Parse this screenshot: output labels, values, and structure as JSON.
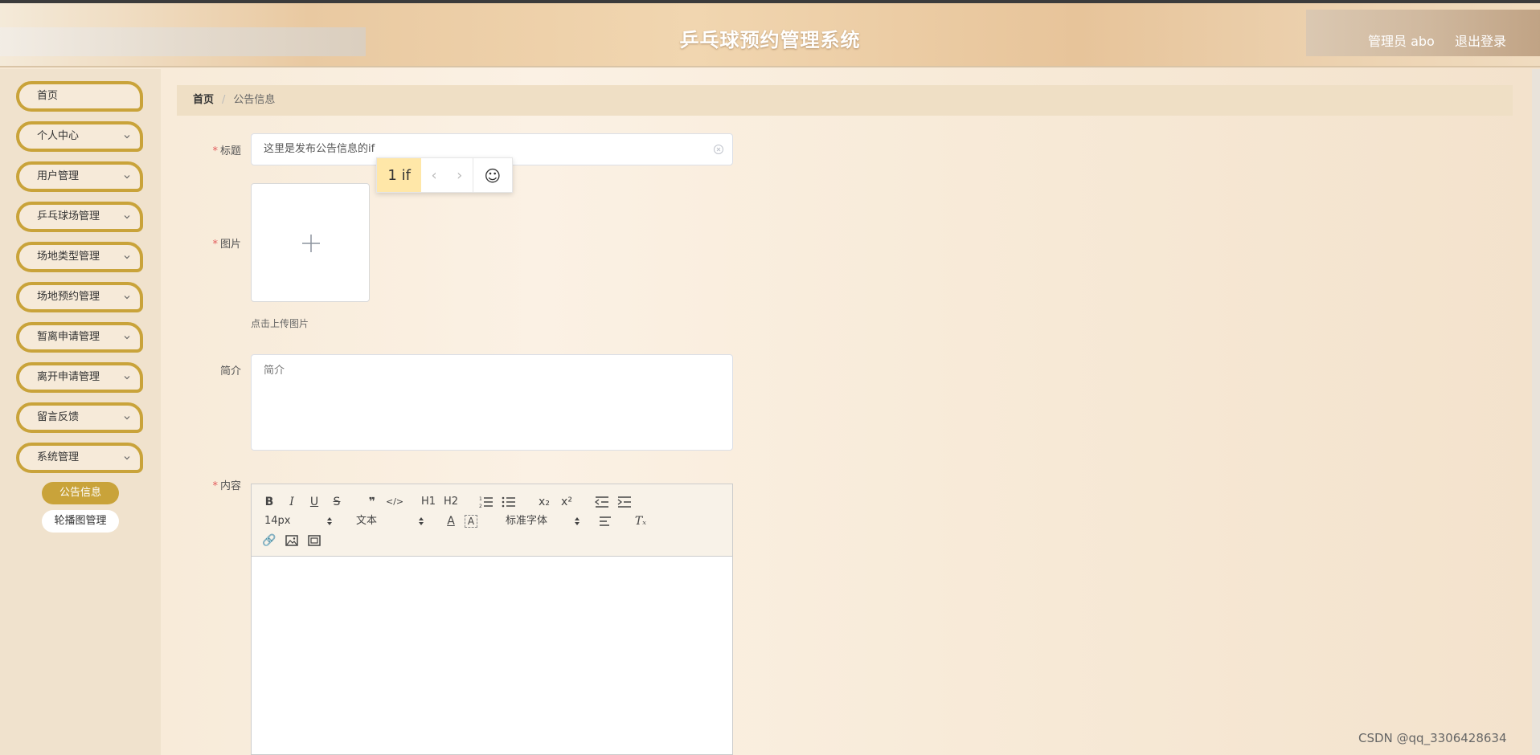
{
  "header": {
    "title": "乒乓球预约管理系统",
    "user": "管理员 abo",
    "logout": "退出登录"
  },
  "sidebar": {
    "items": [
      {
        "label": "首页",
        "has_arrow": false
      },
      {
        "label": "个人中心",
        "has_arrow": true
      },
      {
        "label": "用户管理",
        "has_arrow": true
      },
      {
        "label": "乒乓球场管理",
        "has_arrow": true
      },
      {
        "label": "场地类型管理",
        "has_arrow": true
      },
      {
        "label": "场地预约管理",
        "has_arrow": true
      },
      {
        "label": "暂离申请管理",
        "has_arrow": true
      },
      {
        "label": "离开申请管理",
        "has_arrow": true
      },
      {
        "label": "留言反馈",
        "has_arrow": true
      },
      {
        "label": "系统管理",
        "has_arrow": true
      }
    ],
    "sub_items": [
      {
        "label": "公告信息",
        "active": true
      },
      {
        "label": "轮播图管理",
        "active": false
      }
    ]
  },
  "breadcrumb": {
    "home": "首页",
    "separator": "/",
    "current": "公告信息"
  },
  "form": {
    "required_mark": "*",
    "title_label": "标题",
    "title_value": "这里是发布公告信息的if",
    "image_label": "图片",
    "upload_tip": "点击上传图片",
    "intro_label": "简介",
    "intro_placeholder": "简介",
    "content_label": "内容"
  },
  "ime": {
    "candidate": "1 if"
  },
  "editor": {
    "font_size": "14px",
    "header_select": "文本",
    "font_family": "标准字体",
    "h1": "H1",
    "h2": "H2"
  },
  "watermark": "CSDN @qq_3306428634",
  "colors": {
    "accent": "#c9a33a",
    "breadcrumb_bg": "#efdfc5",
    "sidebar_bg": "#f0e2cd",
    "required": "#e25b5b"
  }
}
